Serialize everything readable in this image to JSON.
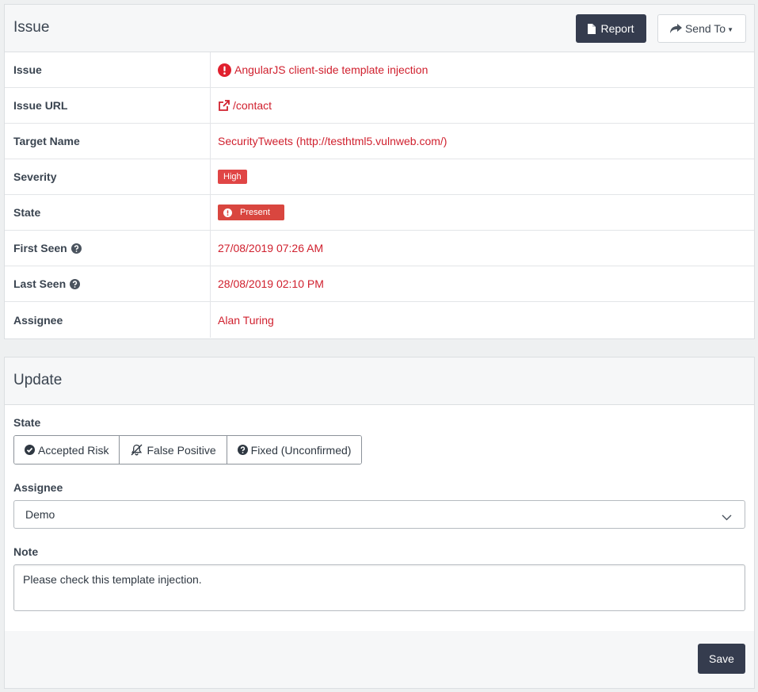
{
  "issue_panel": {
    "title": "Issue",
    "report_label": "Report",
    "send_to_label": "Send To",
    "rows": [
      {
        "label": "Issue",
        "value": "AngularJS client-side template injection"
      },
      {
        "label": "Issue URL",
        "value": "/contact"
      },
      {
        "label": "Target Name",
        "value": "SecurityTweets (http://testhtml5.vulnweb.com/)"
      },
      {
        "label": "Severity",
        "value": "High"
      },
      {
        "label": "State",
        "value": "Present"
      },
      {
        "label": "First Seen",
        "value": "27/08/2019 07:26 AM"
      },
      {
        "label": "Last Seen",
        "value": "28/08/2019 02:10 PM"
      },
      {
        "label": "Assignee",
        "value": "Alan Turing"
      }
    ]
  },
  "update_panel": {
    "title": "Update",
    "state_label": "State",
    "state_options": [
      "Accepted Risk",
      "False Positive",
      "Fixed (Unconfirmed)"
    ],
    "assignee_label": "Assignee",
    "assignee_value": "Demo",
    "note_label": "Note",
    "note_value": "Please check this template injection.",
    "save_label": "Save"
  },
  "colors": {
    "value_red": "#d0202e",
    "dark_button": "#353c4e",
    "severity_high": "#e04545",
    "state_present": "#d9463f"
  },
  "icons": {
    "report": "file-icon",
    "send_to": "share-icon",
    "issue": "exclamation-circle-icon",
    "url": "external-link-icon",
    "help": "question-circle-icon",
    "accepted_risk": "check-circle-icon",
    "false_positive": "bell-slash-icon",
    "fixed": "question-circle-icon",
    "assignee_select": "chevron-down-icon"
  }
}
